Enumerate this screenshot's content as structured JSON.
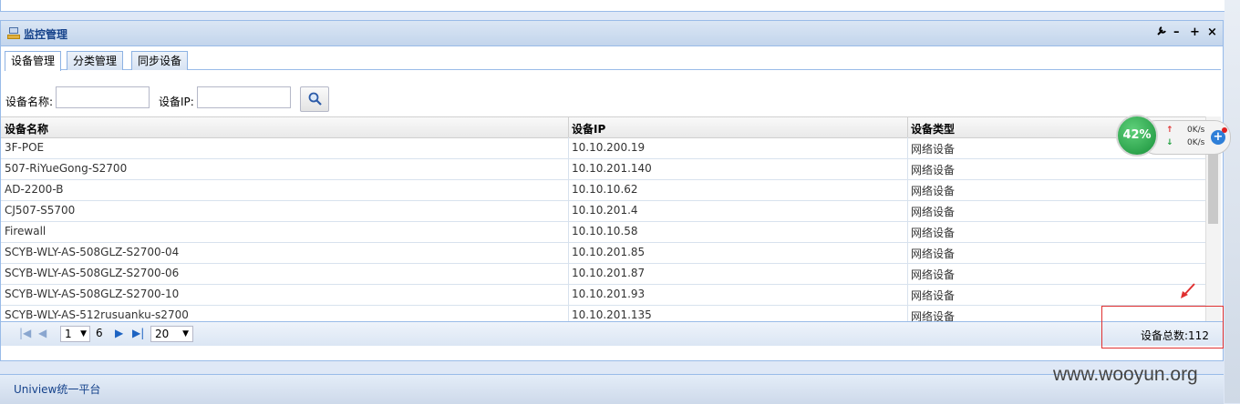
{
  "panel": {
    "title": "监控管理",
    "tools": [
      "wrench-icon",
      "minimize-icon",
      "maximize-icon",
      "close-icon"
    ]
  },
  "tabs": [
    {
      "label": "设备管理",
      "active": true
    },
    {
      "label": "分类管理",
      "active": false
    },
    {
      "label": "同步设备",
      "active": false
    }
  ],
  "search": {
    "name_label": "设备名称:",
    "name_value": "",
    "ip_label": "设备IP:",
    "ip_value": ""
  },
  "grid": {
    "columns": [
      "设备名称",
      "设备IP",
      "设备类型"
    ],
    "rows": [
      [
        "3F-POE",
        "10.10.200.19",
        "网络设备"
      ],
      [
        "507-RiYueGong-S2700",
        "10.10.201.140",
        "网络设备"
      ],
      [
        "AD-2200-B",
        "10.10.10.62",
        "网络设备"
      ],
      [
        "CJ507-S5700",
        "10.10.201.4",
        "网络设备"
      ],
      [
        "Firewall",
        "10.10.10.58",
        "网络设备"
      ],
      [
        "SCYB-WLY-AS-508GLZ-S2700-04",
        "10.10.201.85",
        "网络设备"
      ],
      [
        "SCYB-WLY-AS-508GLZ-S2700-06",
        "10.10.201.87",
        "网络设备"
      ],
      [
        "SCYB-WLY-AS-508GLZ-S2700-10",
        "10.10.201.93",
        "网络设备"
      ],
      [
        "SCYB-WLY-AS-512rusuanku-s2700",
        "10.10.201.135",
        "网络设备"
      ]
    ]
  },
  "paging": {
    "current_page": "1",
    "total_pages": "6",
    "page_size": "20",
    "total_label": "设备总数:112"
  },
  "footer": {
    "text": "Uniview统一平台"
  },
  "watermark": "www.wooyun.org",
  "net_widget": {
    "percent": "42%",
    "up_speed": "0K/s",
    "down_speed": "0K/s"
  },
  "colors": {
    "border": "#99bbe8",
    "title": "#15428b",
    "highlight_box": "#e03030"
  }
}
